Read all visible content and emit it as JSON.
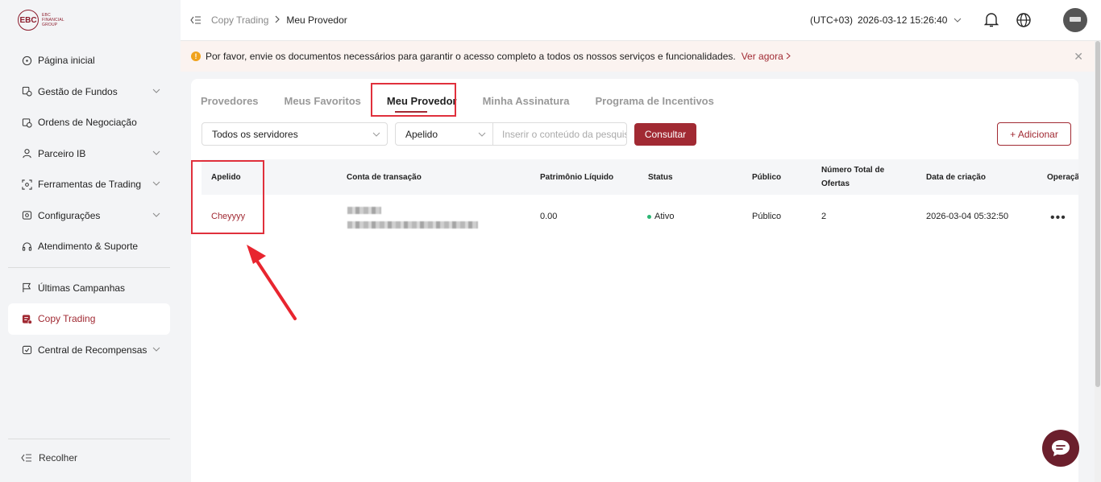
{
  "sidebar": {
    "logo_letters": "EBC",
    "logo_text": "EBC FINANCIAL GROUP",
    "items": [
      {
        "label": "Página inicial",
        "icon": "home-icon"
      },
      {
        "label": "Gestão de Fundos",
        "icon": "funds-icon"
      },
      {
        "label": "Ordens de Negociação",
        "icon": "orders-icon"
      },
      {
        "label": "Parceiro IB",
        "icon": "partner-icon"
      },
      {
        "label": "Ferramentas de Trading",
        "icon": "tools-icon"
      },
      {
        "label": "Configurações",
        "icon": "settings-icon"
      },
      {
        "label": "Atendimento & Suporte",
        "icon": "headset-icon"
      },
      {
        "label": "Últimas Campanhas",
        "icon": "flag-icon"
      },
      {
        "label": "Copy Trading",
        "icon": "copy-trading-icon"
      },
      {
        "label": "Central de Recompensas",
        "icon": "rewards-icon"
      }
    ],
    "collapse_label": "Recolher"
  },
  "header": {
    "breadcrumb_parent": "Copy Trading",
    "breadcrumb_current": "Meu Provedor",
    "timezone": "(UTC+03)",
    "datetime": "2026-03-12 15:26:40"
  },
  "banner": {
    "message": "Por favor, envie os documentos necessários para garantir o acesso completo a todos os nossos serviços e funcionalidades.",
    "link": "Ver agora",
    "close": "✕"
  },
  "tabs": [
    "Provedores",
    "Meus Favoritos",
    "Meu Provedor",
    "Minha Assinatura",
    "Programa de Incentivos"
  ],
  "filters": {
    "server": "Todos os servidores",
    "field": "Apelido",
    "search_placeholder": "Inserir o conteúdo da pesquisa",
    "query_button": "Consultar",
    "add_button": "+ Adicionar"
  },
  "table": {
    "columns": [
      "Apelido",
      "Conta de transação",
      "Patrimônio Líquido",
      "Status",
      "Público",
      "Número Total de Ofertas",
      "Data de criação",
      "Operação"
    ],
    "rows": [
      {
        "nickname": "Cheyyyy",
        "equity": "0.00",
        "status": "Ativo",
        "public": "Público",
        "offers": "2",
        "created": "2026-03-04 05:32:50",
        "more": "•••"
      }
    ]
  },
  "colors": {
    "accent": "#a12a33",
    "active_status": "#2bb673",
    "highlight": "#e0303c"
  }
}
